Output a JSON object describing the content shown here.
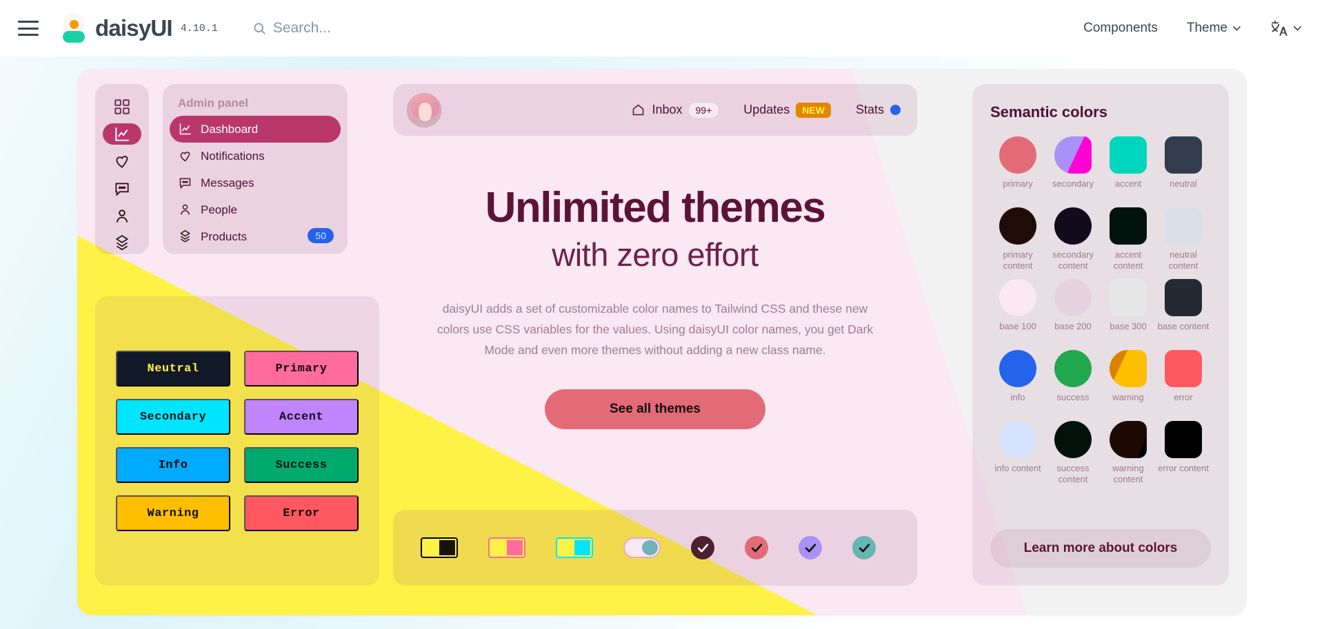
{
  "navbar": {
    "menu_icon": "hamburger-icon",
    "brand": "daisyUI",
    "version": "4.10.1",
    "search_placeholder": "Search...",
    "search_icon": "search-icon",
    "links": [
      {
        "label": "Components",
        "has_chevron": false
      },
      {
        "label": "Theme",
        "has_chevron": true
      }
    ],
    "language_icon": "translate-icon",
    "language_chevron": "chevron-down-icon"
  },
  "preview": {
    "rail": [
      {
        "icon": "grid-icon",
        "active": false
      },
      {
        "icon": "chart-icon",
        "active": true
      },
      {
        "icon": "heart-icon",
        "active": false
      },
      {
        "icon": "message-icon",
        "active": false
      },
      {
        "icon": "person-icon",
        "active": false
      },
      {
        "icon": "box-icon",
        "active": false
      }
    ],
    "menu": {
      "title": "Admin panel",
      "items": [
        {
          "label": "Dashboard",
          "icon": "chart-icon",
          "active": true,
          "badge": ""
        },
        {
          "label": "Notifications",
          "icon": "heart-icon",
          "active": false,
          "badge": ""
        },
        {
          "label": "Messages",
          "icon": "message-icon",
          "active": false,
          "badge": ""
        },
        {
          "label": "People",
          "icon": "person-icon",
          "active": false,
          "badge": ""
        },
        {
          "label": "Products",
          "icon": "box-icon",
          "active": false,
          "badge": "50"
        }
      ]
    },
    "color_buttons": [
      {
        "label": "Neutral",
        "bg": "#111827",
        "fg": "#fff246"
      },
      {
        "label": "Primary",
        "bg": "#ff6b9d",
        "fg": "#160b10"
      },
      {
        "label": "Secondary",
        "bg": "#00e5ff",
        "fg": "#0c1214"
      },
      {
        "label": "Accent",
        "bg": "#c084fc",
        "fg": "#12091a"
      },
      {
        "label": "Info",
        "bg": "#00aaff",
        "fg": "#05080b"
      },
      {
        "label": "Success",
        "bg": "#00a96e",
        "fg": "#03120c"
      },
      {
        "label": "Warning",
        "bg": "#ffbe00",
        "fg": "#160f00"
      },
      {
        "label": "Error",
        "bg": "#ff5861",
        "fg": "#160506"
      }
    ],
    "topbar": {
      "avatar": "user-avatar",
      "links": [
        {
          "label": "Inbox",
          "icon": "home-icon",
          "badge": "99+",
          "badge_type": "pill"
        },
        {
          "label": "Updates",
          "icon": "",
          "badge": "NEW",
          "badge_type": "new"
        },
        {
          "label": "Stats",
          "icon": "",
          "badge": "",
          "badge_type": "dot"
        }
      ]
    },
    "hero": {
      "title": "Unlimited themes",
      "subtitle": "with zero effort",
      "paragraph": "daisyUI adds a set of customizable color names to Tailwind CSS and these new colors use CSS variables for the values. Using daisyUI color names, you get Dark Mode and even more themes without adding a new class name.",
      "cta": "See all themes"
    },
    "controls": {
      "toggles": [
        {
          "name": "toggle-neutral",
          "track": "#fff246",
          "border": "#000000",
          "knob": "#191207"
        },
        {
          "name": "toggle-primary",
          "track": "#fff246",
          "border": "#ff6b9d",
          "knob": "#ff6b9d"
        },
        {
          "name": "toggle-secondary",
          "track": "#fff246",
          "border": "#00e5ff",
          "knob": "#00e5ff"
        },
        {
          "name": "toggle-accent",
          "track": "#f7e8f2",
          "border": "#e9a9c6",
          "knob": "#6fb3b5"
        }
      ],
      "checkboxes": [
        {
          "name": "checkbox-neutral",
          "bg": "#4c2030",
          "check": "#ffffff"
        },
        {
          "name": "checkbox-primary",
          "bg": "#e36b77",
          "check": "#111111"
        },
        {
          "name": "checkbox-secondary",
          "bg": "#a991f7",
          "check": "#111111"
        },
        {
          "name": "checkbox-accent",
          "bg": "#66b6b3",
          "check": "#111111"
        }
      ]
    },
    "semantic": {
      "title": "Semantic colors",
      "cta": "Learn more about colors",
      "swatches": [
        {
          "label": "primary",
          "color": "#e36b77",
          "shape": "circle"
        },
        {
          "label": "secondary",
          "color": "#a991f7",
          "shape": "split",
          "color2": "#ff00d5"
        },
        {
          "label": "accent",
          "color": "#00d6bd",
          "shape": "square"
        },
        {
          "label": "neutral",
          "color": "#333c4d",
          "shape": "square"
        },
        {
          "label": "primary content",
          "color": "#1f0b08",
          "shape": "circle"
        },
        {
          "label": "secondary content",
          "color": "#120b1c",
          "shape": "circle"
        },
        {
          "label": "accent content",
          "color": "#02120d",
          "shape": "square"
        },
        {
          "label": "neutral content",
          "color": "#d9dfe7",
          "shape": "square"
        },
        {
          "label": "base 100",
          "color": "#fae8f3",
          "shape": "circle"
        },
        {
          "label": "base 200",
          "color": "#e5d2de",
          "shape": "circle"
        },
        {
          "label": "base 300",
          "color": "#e7e7e7",
          "shape": "square"
        },
        {
          "label": "base content",
          "color": "#242933",
          "shape": "square"
        },
        {
          "label": "info",
          "color": "#2563eb",
          "shape": "circle"
        },
        {
          "label": "success",
          "color": "#22a94f",
          "shape": "circle"
        },
        {
          "label": "warning",
          "color": "#ffbe00",
          "shape": "split2",
          "color2": "#d98200"
        },
        {
          "label": "error",
          "color": "#ff5861",
          "shape": "square"
        },
        {
          "label": "info content",
          "color": "#d4e2ff",
          "shape": "circle"
        },
        {
          "label": "success content",
          "color": "#02120a",
          "shape": "circle"
        },
        {
          "label": "warning content",
          "color": "#1d0a03",
          "shape": "split3",
          "color2": "#000000"
        },
        {
          "label": "error content",
          "color": "#000000",
          "shape": "square"
        }
      ]
    }
  }
}
